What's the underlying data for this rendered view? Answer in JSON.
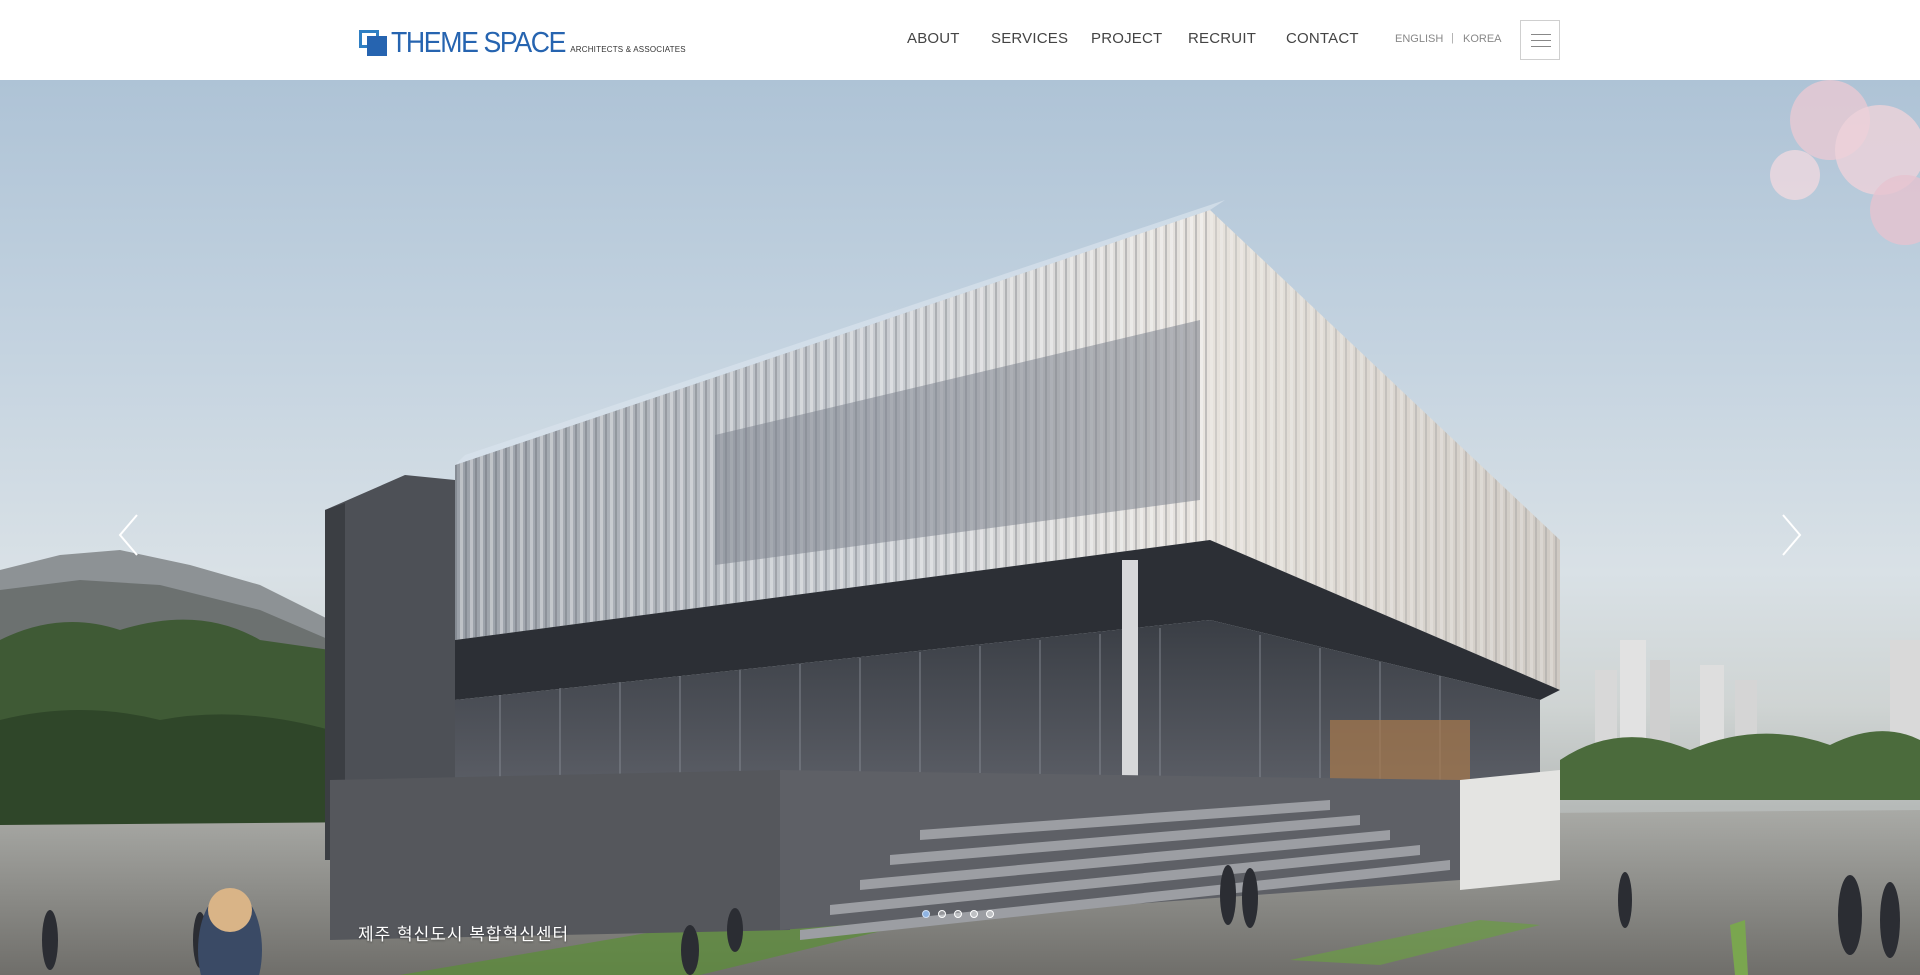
{
  "header": {
    "logo": {
      "main": "THEME SPACE",
      "sub": "ARCHITECTS & ASSOCIATES"
    },
    "nav": [
      {
        "label": "ABOUT"
      },
      {
        "label": "SERVICES"
      },
      {
        "label": "PROJECT"
      },
      {
        "label": "RECRUIT"
      },
      {
        "label": "CONTACT"
      }
    ],
    "languages": [
      {
        "label": "ENGLISH"
      },
      {
        "label": "KOREA"
      }
    ],
    "lang_separator": "|",
    "menu_icon": "hamburger-icon"
  },
  "hero": {
    "caption": "제주 혁신도시 복합혁신센터",
    "prev_icon": "chevron-left-icon",
    "next_icon": "chevron-right-icon",
    "slide_count": 5,
    "active_slide": 1
  },
  "colors": {
    "brand": "#2664b0",
    "brand_light": "#2f7fc3",
    "nav_text": "#444444",
    "lang_text": "#888888"
  }
}
